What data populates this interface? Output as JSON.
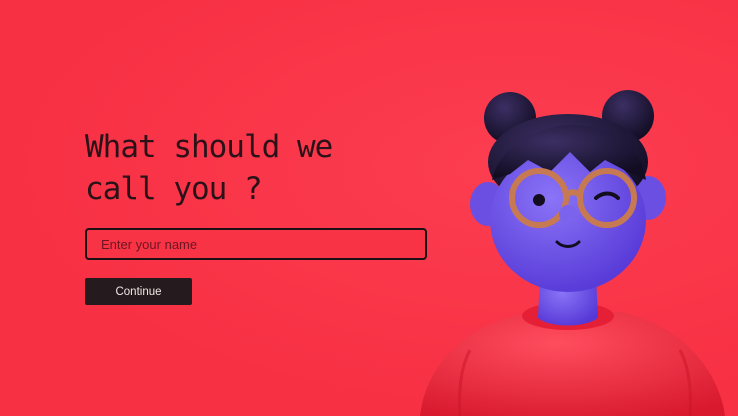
{
  "onboarding": {
    "heading_line1": "What should we",
    "heading_line2": "call you ?",
    "name_input": {
      "placeholder": "Enter your name",
      "value": ""
    },
    "continue_label": "Continue"
  },
  "colors": {
    "background": "#fa3548",
    "text": "#2a1218",
    "button_bg": "#251a1d",
    "avatar_skin": "#6f55e8",
    "avatar_shirt": "#f83044",
    "avatar_hair": "#1d1536",
    "glasses": "#c77a52"
  },
  "avatar": {
    "icon": "waving-girl-3d-avatar"
  }
}
